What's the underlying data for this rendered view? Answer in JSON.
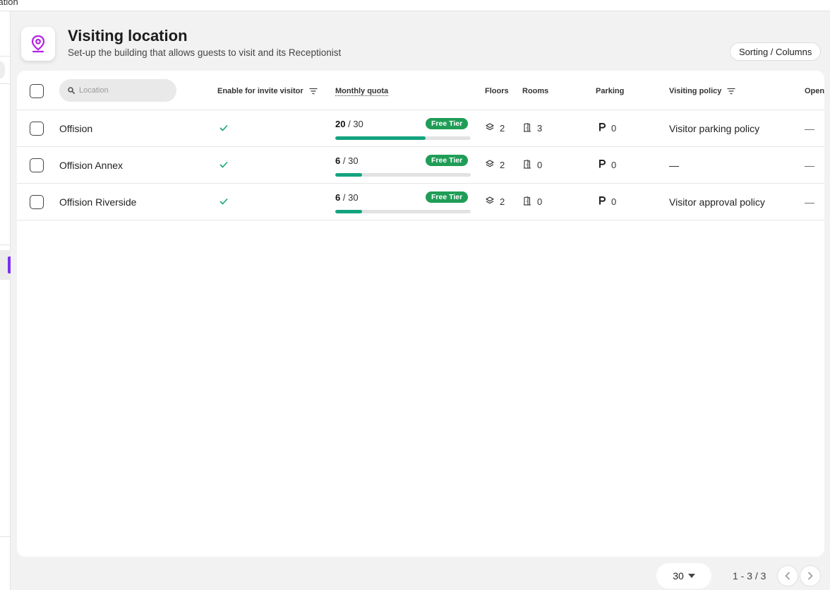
{
  "window": {
    "title_fragment": "cation"
  },
  "header": {
    "title": "Visiting location",
    "subtitle": "Set-up the building that allows guests to visit and its Receptionist",
    "icon": "location-pin-icon",
    "sort_button": "Sorting / Columns"
  },
  "colors": {
    "accent": "#7b2ff2",
    "quota_fill": "#14a37f",
    "badge": "#1f9d57",
    "check": "#14a37f"
  },
  "table": {
    "search_placeholder": "Location",
    "columns": {
      "enable": "Enable for invite visitor",
      "quota": "Monthly quota",
      "floors": "Floors",
      "rooms": "Rooms",
      "parking": "Parking",
      "policy": "Visiting policy",
      "open": "Open"
    },
    "rows": [
      {
        "name": "Offision",
        "enabled": true,
        "quota_used": "20",
        "quota_sep": "/ 30",
        "quota_fraction": 0.667,
        "tier": "Free Tier",
        "floors": "2",
        "rooms": "3",
        "parking": "0",
        "policy": "Visitor parking policy",
        "open": "—"
      },
      {
        "name": "Offision Annex",
        "enabled": true,
        "quota_used": "6",
        "quota_sep": "/ 30",
        "quota_fraction": 0.2,
        "tier": "Free Tier",
        "floors": "2",
        "rooms": "0",
        "parking": "0",
        "policy": "—",
        "open": "—"
      },
      {
        "name": "Offision Riverside",
        "enabled": true,
        "quota_used": "6",
        "quota_sep": "/ 30",
        "quota_fraction": 0.2,
        "tier": "Free Tier",
        "floors": "2",
        "rooms": "0",
        "parking": "0",
        "policy": "Visitor approval policy",
        "open": "—"
      }
    ]
  },
  "pagination": {
    "per_page": "30",
    "range": "1 - 3 / 3"
  }
}
